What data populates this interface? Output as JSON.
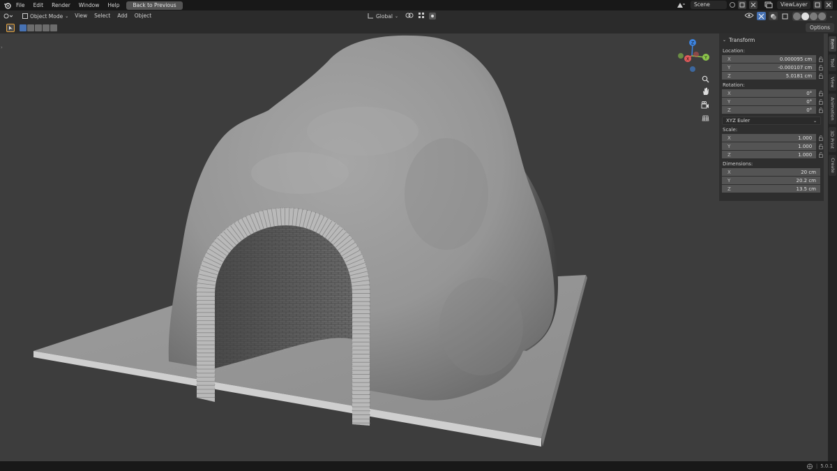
{
  "topbar": {
    "menus": [
      "File",
      "Edit",
      "Render",
      "Window",
      "Help"
    ],
    "back_button": "Back to Previous",
    "scene_field": "Scene",
    "view_layer_field": "ViewLayer"
  },
  "viewport_header": {
    "mode": "Object Mode",
    "menus": [
      "View",
      "Select",
      "Add",
      "Object"
    ],
    "orientation": "Global",
    "options": "Options"
  },
  "npanel": {
    "section_title": "Transform",
    "location_label": "Location:",
    "location": [
      {
        "axis": "X",
        "value": "0.000095 cm"
      },
      {
        "axis": "Y",
        "value": "-0.000107 cm"
      },
      {
        "axis": "Z",
        "value": "5.0181 cm"
      }
    ],
    "rotation_label": "Rotation:",
    "rotation": [
      {
        "axis": "X",
        "value": "0°"
      },
      {
        "axis": "Y",
        "value": "0°"
      },
      {
        "axis": "Z",
        "value": "0°"
      }
    ],
    "rotation_mode": "XYZ Euler",
    "scale_label": "Scale:",
    "scale": [
      {
        "axis": "X",
        "value": "1.000"
      },
      {
        "axis": "Y",
        "value": "1.000"
      },
      {
        "axis": "Z",
        "value": "1.000"
      }
    ],
    "dimensions_label": "Dimensions:",
    "dimensions": [
      {
        "axis": "X",
        "value": "20 cm"
      },
      {
        "axis": "Y",
        "value": "20.2 cm"
      },
      {
        "axis": "Z",
        "value": "13.5 cm"
      }
    ]
  },
  "side_tabs": [
    "Item",
    "Tool",
    "View",
    "Animation",
    "3D Print",
    "Create"
  ],
  "gizmo": {
    "x": "X",
    "y": "Y",
    "z": "Z"
  },
  "statusbar": {
    "version": "5.0.1"
  },
  "colors": {
    "accent_blue": "#4772b3",
    "active_orange": "#e6a23c",
    "axis_x": "#e05a5a",
    "axis_y": "#8bc34a",
    "axis_z": "#3d84e0"
  }
}
